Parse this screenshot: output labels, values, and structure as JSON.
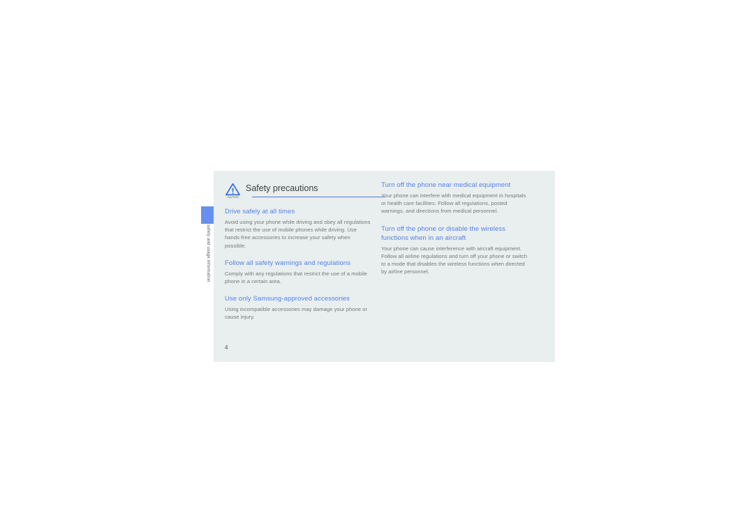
{
  "page": {
    "background_color": "#e9eeee",
    "number": "4",
    "side_tab_color": "#6690ef",
    "side_label": "safety and usage information",
    "heading_color": "#5282ee",
    "body_color": "#74787b",
    "rule_color": "#4a76e0"
  },
  "header": {
    "icon": "caution-triangle-icon",
    "icon_label": "CAUTION",
    "title": "Safety precautions"
  },
  "columns": {
    "left": [
      {
        "heading": "Drive safely at all times",
        "body": "Avoid using your phone while driving and obey all regulations that restrict the use of mobile phones while driving. Use hands-free accessories to increase your safety when possible."
      },
      {
        "heading": "Follow all safety warnings and regulations",
        "body": "Comply with any regulations that restrict the use of a mobile phone in a certain area."
      },
      {
        "heading": "Use only Samsung-approved accessories",
        "body": "Using incompatible accessories may damage your phone or cause injury."
      }
    ],
    "right": [
      {
        "heading": "Turn off the phone near medical equipment",
        "body": "Your phone can interfere with medical equipment in hospitals or health care facilities. Follow all regulations, posted warnings, and directions from medical personnel."
      },
      {
        "heading": "Turn off the phone or disable the wireless functions when in an aircraft",
        "body": "Your phone can cause interference with aircraft equipment. Follow all airline regulations and turn off your phone or switch to a mode that disables the wireless functions when directed by airline personnel."
      }
    ]
  }
}
